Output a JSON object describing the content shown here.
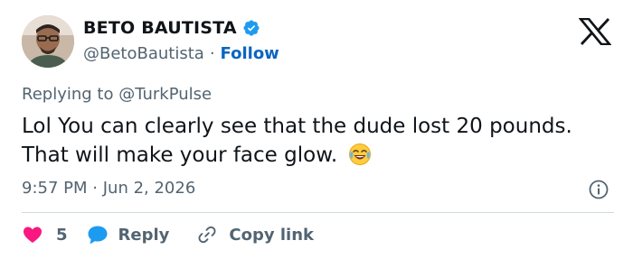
{
  "author": {
    "name": "BETO BAUTISTA",
    "handle": "@BetoBautista",
    "separator": "·",
    "follow_label": "Follow"
  },
  "tweet": {
    "replying_prefix": "Replying to ",
    "replying_to": "@TurkPulse",
    "text": "Lol You can clearly see that the dude lost 20 pounds. That will make your face glow.",
    "emoji": "face-with-tears-of-joy",
    "time": "9:57 PM",
    "date_separator": "·",
    "date": "Jun 2, 2026"
  },
  "actions": {
    "likes_count": "5",
    "reply_label": "Reply",
    "copy_link_label": "Copy link"
  },
  "colors": {
    "accent_blue": "#0b65c2",
    "verified_blue": "#1d9bf0",
    "like_red": "#f91880",
    "muted_text": "#536471",
    "primary_text": "#0f1419"
  },
  "icons": [
    "verified-badge-icon",
    "x-logo-icon",
    "info-icon",
    "heart-icon",
    "reply-bubble-icon",
    "link-icon"
  ]
}
